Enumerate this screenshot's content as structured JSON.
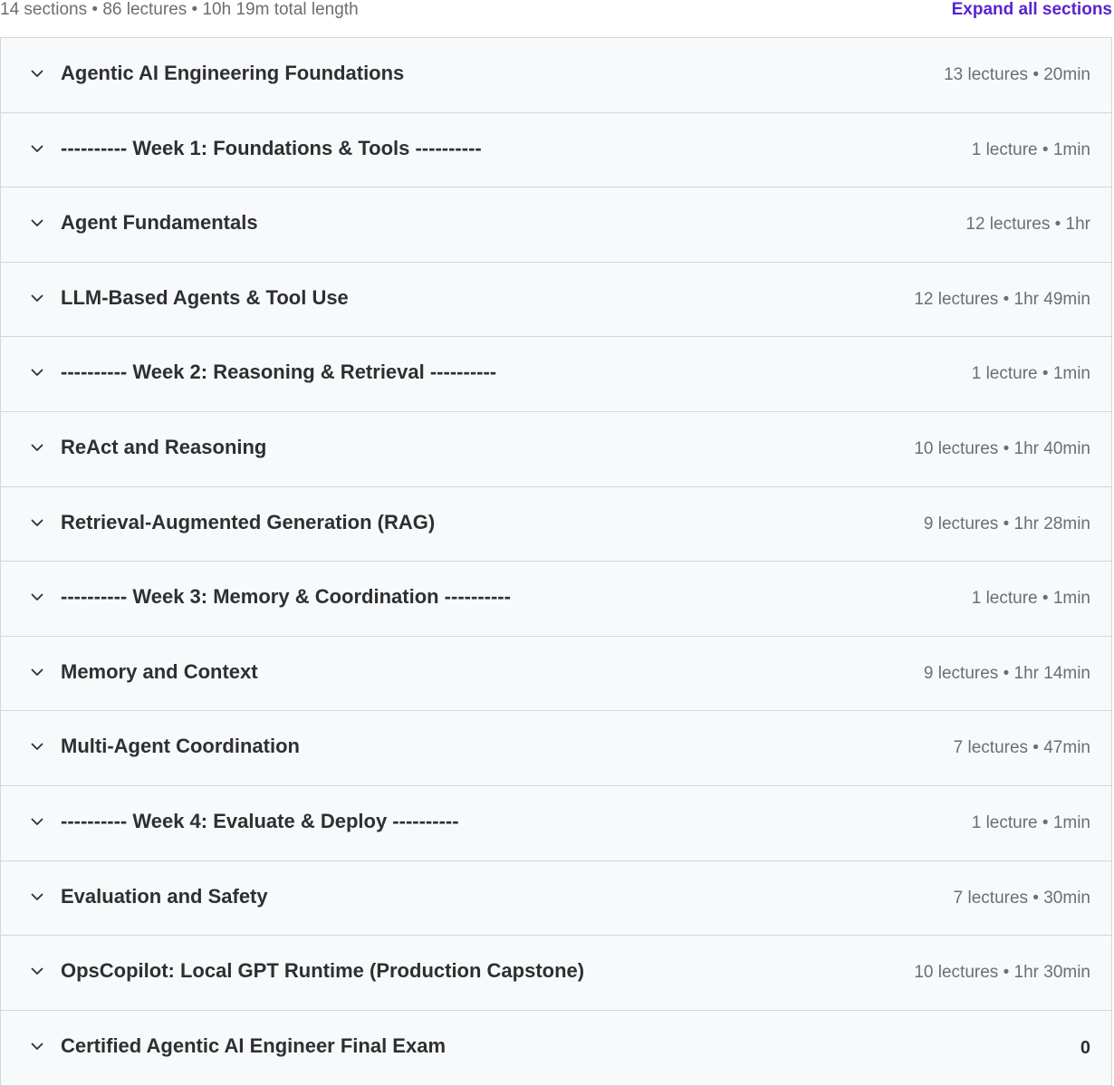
{
  "summary": {
    "text": "14 sections • 86 lectures • 10h 19m total length",
    "expand_all_label": "Expand all sections"
  },
  "sections": [
    {
      "title": "Agentic AI Engineering Foundations",
      "meta": "13 lectures • 20min"
    },
    {
      "title": "---------- Week 1: Foundations & Tools ----------",
      "meta": "1 lecture • 1min"
    },
    {
      "title": "Agent Fundamentals",
      "meta": "12 lectures • 1hr"
    },
    {
      "title": "LLM-Based Agents & Tool Use",
      "meta": "12 lectures • 1hr 49min"
    },
    {
      "title": "---------- Week 2: Reasoning & Retrieval ----------",
      "meta": "1 lecture • 1min"
    },
    {
      "title": "ReAct and Reasoning",
      "meta": "10 lectures • 1hr 40min"
    },
    {
      "title": "Retrieval-Augmented Generation (RAG)",
      "meta": "9 lectures • 1hr 28min"
    },
    {
      "title": "---------- Week 3: Memory & Coordination ----------",
      "meta": "1 lecture • 1min"
    },
    {
      "title": "Memory and Context",
      "meta": "9 lectures • 1hr 14min"
    },
    {
      "title": "Multi-Agent Coordination",
      "meta": "7 lectures • 47min"
    },
    {
      "title": "---------- Week 4: Evaluate & Deploy ----------",
      "meta": "1 lecture • 1min"
    },
    {
      "title": "Evaluation and Safety",
      "meta": "7 lectures • 30min"
    },
    {
      "title": "OpsCopilot: Local GPT Runtime (Production Capstone)",
      "meta": "10 lectures • 1hr 30min"
    },
    {
      "title": "Certified Agentic AI Engineer Final Exam",
      "meta": "0"
    }
  ],
  "icons": {
    "section_toggle": "chevron-down-icon"
  },
  "colors": {
    "accent": "#5624d0",
    "section_bg": "#f7f9fa",
    "border": "#d1d7dc",
    "text_primary": "#2d2f31",
    "text_secondary": "#6a6f73"
  }
}
